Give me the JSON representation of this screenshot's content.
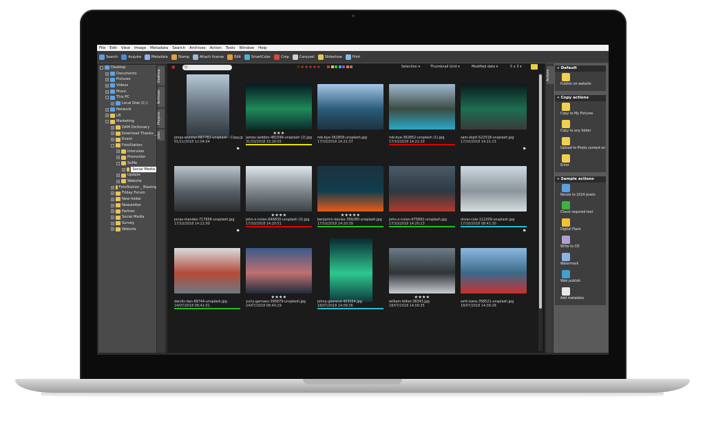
{
  "menu": [
    "File",
    "Edit",
    "View",
    "Image",
    "Metadata",
    "Search",
    "Archives",
    "Action",
    "Tools",
    "Window",
    "Help"
  ],
  "toolbar": [
    {
      "label": "Search",
      "icon": "search-icon",
      "color": "#5aa0e0"
    },
    {
      "label": "Acquire",
      "icon": "acquire-icon",
      "color": "#4e88d6"
    },
    {
      "label": "Metadata",
      "icon": "metadata-icon",
      "color": "#8ab4e8"
    },
    {
      "label": "Stamp",
      "icon": "stamp-icon",
      "color": "#e0a040"
    },
    {
      "label": "Attach license",
      "icon": "license-icon",
      "color": "#9bb8d8"
    },
    {
      "label": "Edit",
      "icon": "edit-icon",
      "color": "#e59a3b"
    },
    {
      "label": "SmartColor",
      "icon": "smartcolor-icon",
      "color": "#4bb0e0"
    },
    {
      "label": "Crop",
      "icon": "crop-icon",
      "color": "#d64a3a"
    },
    {
      "label": "Carousel",
      "icon": "carousel-icon",
      "color": "#cfcfcf"
    },
    {
      "label": "Slideshow",
      "icon": "slideshow-icon",
      "color": "#e8c35a"
    },
    {
      "label": "Print",
      "icon": "print-icon",
      "color": "#8bb8e8"
    }
  ],
  "tree": [
    {
      "label": "Desktop",
      "level": 0,
      "type": "blue",
      "exp": ""
    },
    {
      "label": "Documents",
      "level": 1,
      "type": "blue",
      "exp": "+"
    },
    {
      "label": "Pictures",
      "level": 1,
      "type": "blue",
      "exp": "+"
    },
    {
      "label": "Videos",
      "level": 1,
      "type": "blue",
      "exp": "+"
    },
    {
      "label": "Music",
      "level": 1,
      "type": "blue",
      "exp": "+"
    },
    {
      "label": "This PC",
      "level": 1,
      "type": "blue",
      "exp": "-"
    },
    {
      "label": "Local Disk (C:)",
      "level": 2,
      "type": "blue",
      "exp": "+"
    },
    {
      "label": "Network",
      "level": 1,
      "type": "blue",
      "exp": "+"
    },
    {
      "label": "LB",
      "level": 1,
      "type": "folder",
      "exp": "+"
    },
    {
      "label": "Marketing",
      "level": 1,
      "type": "folder",
      "exp": "-"
    },
    {
      "label": "DAM Dictionary",
      "level": 2,
      "type": "folder",
      "exp": "+"
    },
    {
      "label": "Download Thanks _",
      "level": 2,
      "type": "folder",
      "exp": "+"
    },
    {
      "label": "Event",
      "level": 2,
      "type": "folder",
      "exp": "+"
    },
    {
      "label": "FotoStation",
      "level": 2,
      "type": "folder",
      "exp": "-"
    },
    {
      "label": "Interview",
      "level": 3,
      "type": "folder",
      "exp": "+"
    },
    {
      "label": "Promotion",
      "level": 3,
      "type": "folder",
      "exp": "+"
    },
    {
      "label": "SoMe",
      "level": 3,
      "type": "folder",
      "exp": "-"
    },
    {
      "label": "Social Media",
      "level": 4,
      "type": "folder",
      "exp": "+",
      "selected": true
    },
    {
      "label": "Update",
      "level": 3,
      "type": "folder",
      "exp": "+"
    },
    {
      "label": "Website",
      "level": 3,
      "type": "folder",
      "exp": "+"
    },
    {
      "label": "FotoStation _ Blazing",
      "level": 2,
      "type": "folder",
      "exp": "+"
    },
    {
      "label": "Friday Forum",
      "level": 2,
      "type": "folder",
      "exp": "+"
    },
    {
      "label": "New folder",
      "level": 2,
      "type": "folder",
      "exp": "+"
    },
    {
      "label": "Newsletter",
      "level": 2,
      "type": "folder",
      "exp": "+"
    },
    {
      "label": "Partner",
      "level": 2,
      "type": "folder",
      "exp": "+"
    },
    {
      "label": "Social Media",
      "level": 2,
      "type": "folder",
      "exp": "+"
    },
    {
      "label": "Survey",
      "level": 2,
      "type": "folder",
      "exp": "+"
    },
    {
      "label": "Website",
      "level": 2,
      "type": "folder",
      "exp": "+"
    }
  ],
  "vtabs": [
    "Desktop",
    "Archives",
    "Projects",
    "Jobs"
  ],
  "mainbar": {
    "search_placeholder": "Q·",
    "rating_filter": "×★★★★★",
    "selection": "Selection",
    "view": "Thumbnail Grid",
    "sort": "Modified date",
    "grid_size": "5 x 3"
  },
  "photos": [
    {
      "name": "jonas-wurster-687782-unsplash - Copy.jpg",
      "date": "01/11/2018 12:04:04",
      "stars": "",
      "bar": "",
      "colors": [
        "#b6c8d6",
        "#5f6d78",
        "#2e3438"
      ],
      "portrait": true,
      "flag": true
    },
    {
      "name": "james-seddon-481599-unsplash (2).jpg",
      "date": "31/10/2018 15:16:03",
      "stars": "★★★",
      "bar": "#e6e600",
      "colors": [
        "#061a22",
        "#1f8a5b",
        "#0c2c2a"
      ],
      "portrait": false,
      "flag": false
    },
    {
      "name": "rob-bye-362858-unsplash.jpg",
      "date": "17/10/2018 14:21:37",
      "stars": "",
      "bar": "",
      "colors": [
        "#a6c6e6",
        "#2b5b7a",
        "#1d3340"
      ],
      "portrait": false,
      "flag": false
    },
    {
      "name": "rob-bye-362852-unsplash (1).jpg",
      "date": "17/10/2018 14:21:20",
      "stars": "",
      "bar": "#e00000",
      "colors": [
        "#9fb8d0",
        "#3c4c42",
        "#2aa8c8"
      ],
      "portrait": false,
      "flag": false
    },
    {
      "name": "sam-ekpit-522518-unsplash.jpg",
      "date": "17/10/2018 14:21:13",
      "stars": "",
      "bar": "",
      "colors": [
        "#0c1a1c",
        "#1b6f52",
        "#3a3a3a"
      ],
      "portrait": false,
      "flag": true
    },
    {
      "name": "jonas-mendes-717856-unsplash.jpg",
      "date": "17/10/2018 14:21:00",
      "stars": "",
      "bar": "",
      "colors": [
        "#bcc5cc",
        "#596168",
        "#2b2e30"
      ],
      "portrait": false,
      "flag": true
    },
    {
      "name": "john-o-nolan-646830-unsplash (2).jpg",
      "date": "17/10/2018 14:20:51",
      "stars": "★★★★",
      "bar": "#e00000",
      "colors": [
        "#dfe6ea",
        "#7d868c",
        "#3c4246"
      ],
      "portrait": false,
      "flag": false
    },
    {
      "name": "benjamin-davies-399280-unsplash.jpg",
      "date": "17/10/2018 14:20:39",
      "stars": "★★★★★",
      "bar": "#20c020",
      "colors": [
        "#1e3140",
        "#0f3e4c",
        "#e85a1a"
      ],
      "portrait": false,
      "flag": false
    },
    {
      "name": "john-o-nolan-675892-unsplash.jpg",
      "date": "17/10/2018 14:20:23",
      "stars": "",
      "bar": "#20c020",
      "colors": [
        "#4a5a66",
        "#2c3a44",
        "#b23a2a"
      ],
      "portrait": false,
      "flag": false
    },
    {
      "name": "oliver-cole-112209-unsplash.jpg",
      "date": "17/10/2018 08:41:30",
      "stars": "",
      "bar": "#20c0d0",
      "colors": [
        "#ccd8e0",
        "#8a949a",
        "#d6dde0"
      ],
      "portrait": false,
      "flag": true
    },
    {
      "name": "daniilz-dan-89744-unsplash.jpg",
      "date": "24/07/2018 08:41:01",
      "stars": "",
      "bar": "#20c020",
      "colors": [
        "#d8dde0",
        "#b44a3a",
        "#6c7a82"
      ],
      "portrait": false,
      "flag": false
    },
    {
      "name": "yuriy-garnaev-395879-unsplash.jpg",
      "date": "24/07/2018 08:40:29",
      "stars": "★★★★",
      "bar": "",
      "colors": [
        "#3a5a8a",
        "#c07070",
        "#1e2c3c"
      ],
      "portrait": false,
      "flag": false
    },
    {
      "name": "johny-goerend-403554.jpg",
      "date": "18/07/2018 14:09:36",
      "stars": "",
      "bar": "#20c0d0",
      "colors": [
        "#0a2a30",
        "#2ec890",
        "#0e3a3e"
      ],
      "portrait": true,
      "flag": false
    },
    {
      "name": "william-felker-38343.jpg",
      "date": "18/07/2018 14:09:35",
      "stars": "★★★★",
      "bar": "",
      "colors": [
        "#6c7c86",
        "#2e3438",
        "#c8ccd0"
      ],
      "portrait": false,
      "flag": false
    },
    {
      "name": "seth-kane-358521-unsplash.jpg",
      "date": "18/07/2018 14:09:28",
      "stars": "",
      "bar": "",
      "colors": [
        "#8cb8e0",
        "#3a6a8a",
        "#c83030"
      ],
      "portrait": false,
      "flag": false
    }
  ],
  "right_tab": "Actions",
  "groups": [
    {
      "title": "Default",
      "actions": [
        {
          "label": "Publish on website",
          "icon": "publish-icon",
          "color": "#f0d050"
        }
      ]
    },
    {
      "title": "Copy actions",
      "actions": [
        {
          "label": "Copy to My Pictures",
          "icon": "copy-icon",
          "color": "#f0d050"
        },
        {
          "label": "Copy to any folder",
          "icon": "folder-icon",
          "color": "#f0d050"
        },
        {
          "label": "Upload to Photo contest on",
          "icon": "upload-icon",
          "color": "#f0d050"
        },
        {
          "label": "Enter",
          "icon": "enter-icon",
          "color": "#f0d050"
        }
      ]
    },
    {
      "title": "Sample actions",
      "actions": [
        {
          "label": "Resize to 1024 pixels",
          "icon": "resize-icon",
          "color": "#5aa0e0"
        },
        {
          "label": "Check required text",
          "icon": "check-icon",
          "color": "#40b040"
        },
        {
          "label": "Digital Flash",
          "icon": "flash-icon",
          "color": "#f0c030"
        },
        {
          "label": "Write to CD",
          "icon": "cd-icon",
          "color": "#b0a0d0"
        },
        {
          "label": "Watermark",
          "icon": "watermark-icon",
          "color": "#8ab4e8"
        },
        {
          "label": "Web publish",
          "icon": "web-icon",
          "color": "#40a0d0"
        },
        {
          "label": "Add metadata",
          "icon": "add-metadata-icon",
          "color": "#e8e8e8"
        }
      ]
    }
  ]
}
